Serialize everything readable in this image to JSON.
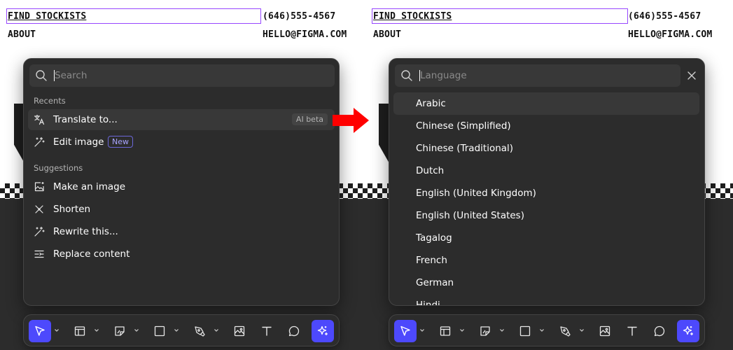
{
  "canvas": {
    "site_left": {
      "find_stockists": "FIND STOCKISTS",
      "about": "ABOUT",
      "phone": "(646)555-4567",
      "email": "HELLO@FIGMA.COM"
    },
    "site_right": {
      "find_stockists": "FIND STOCKISTS",
      "about": "ABOUT",
      "phone": "(646)555-4567",
      "email": "HELLO@FIGMA.COM"
    }
  },
  "command_panel": {
    "search": {
      "value": "",
      "placeholder": "Search"
    },
    "recents_label": "Recents",
    "recents": [
      {
        "label": "Translate to...",
        "icon": "translate-icon",
        "badge": "AI beta",
        "active": true
      },
      {
        "label": "Edit image",
        "icon": "magic-wand-icon",
        "badge": "New",
        "active": false
      }
    ],
    "suggestions_label": "Suggestions",
    "suggestions": [
      {
        "label": "Make an image",
        "icon": "image-sparkle-icon"
      },
      {
        "label": "Shorten",
        "icon": "shorten-icon"
      },
      {
        "label": "Rewrite this...",
        "icon": "magic-wand-icon"
      },
      {
        "label": "Replace content",
        "icon": "replace-content-icon"
      }
    ]
  },
  "language_panel": {
    "search": {
      "value": "",
      "placeholder": "Language"
    },
    "languages": [
      {
        "label": "Arabic",
        "active": true
      },
      {
        "label": "Chinese (Simplified)",
        "active": false
      },
      {
        "label": "Chinese (Traditional)",
        "active": false
      },
      {
        "label": "Dutch",
        "active": false
      },
      {
        "label": "English (United Kingdom)",
        "active": false
      },
      {
        "label": "English (United States)",
        "active": false
      },
      {
        "label": "Tagalog",
        "active": false
      },
      {
        "label": "French",
        "active": false
      },
      {
        "label": "German",
        "active": false
      },
      {
        "label": "Hindi",
        "active": false
      }
    ]
  },
  "toolbar": {
    "tools": [
      {
        "name": "move-tool",
        "icon": "cursor-icon",
        "active": true,
        "dropdown": true
      },
      {
        "name": "frame-tool",
        "icon": "frame-icon",
        "active": false,
        "dropdown": true
      },
      {
        "name": "sticky-tool",
        "icon": "sticky-note-icon",
        "active": false,
        "dropdown": true
      },
      {
        "name": "shape-tool",
        "icon": "square-icon",
        "active": false,
        "dropdown": true
      },
      {
        "name": "pen-tool",
        "icon": "pen-icon",
        "active": false,
        "dropdown": true
      },
      {
        "name": "image-tool",
        "icon": "image-icon",
        "active": false,
        "dropdown": false
      },
      {
        "name": "text-tool",
        "icon": "text-icon",
        "active": false,
        "dropdown": false
      },
      {
        "name": "comment-tool",
        "icon": "comment-icon",
        "active": false,
        "dropdown": false
      },
      {
        "name": "ai-tool",
        "icon": "ai-sparkle-icon",
        "active": true,
        "dropdown": false
      }
    ]
  },
  "colors": {
    "accent": "#4d49fc",
    "panel_bg": "#2c2c2c",
    "item_hover": "#383838",
    "arrow": "#ff0000",
    "selection": "#9747ff"
  }
}
